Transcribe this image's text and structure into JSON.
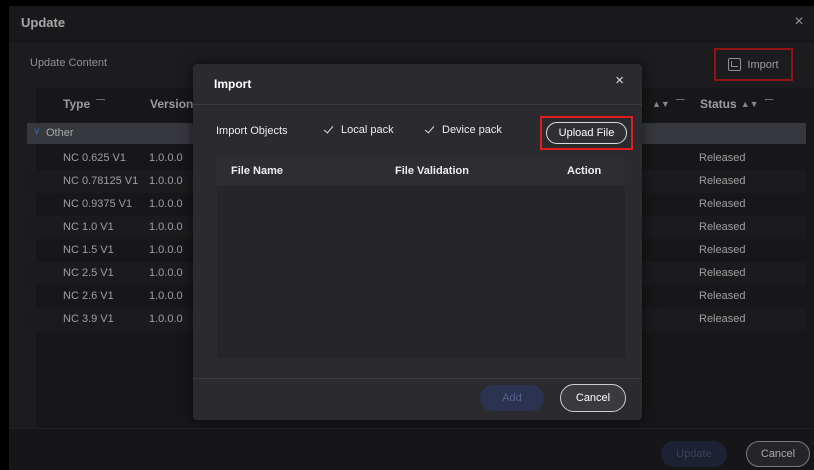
{
  "window": {
    "title": "Update",
    "close_icon": "×"
  },
  "section": {
    "title": "Update Content",
    "import_label": "Import"
  },
  "table": {
    "columns": {
      "type": "Type",
      "version": "Version",
      "status": "Status"
    },
    "group": {
      "label": "Other"
    },
    "rows": [
      {
        "type": "NC 0.625 V1",
        "version": "1.0.0.0",
        "status": "Released"
      },
      {
        "type": "NC 0.78125 V1",
        "version": "1.0.0.0",
        "status": "Released"
      },
      {
        "type": "NC 0.9375 V1",
        "version": "1.0.0.0",
        "status": "Released"
      },
      {
        "type": "NC 1.0 V1",
        "version": "1.0.0.0",
        "status": "Released"
      },
      {
        "type": "NC 1.5 V1",
        "version": "1.0.0.0",
        "status": "Released"
      },
      {
        "type": "NC 2.5 V1",
        "version": "1.0.0.0",
        "status": "Released"
      },
      {
        "type": "NC 2.6 V1",
        "version": "1.0.0.0",
        "status": "Released"
      },
      {
        "type": "NC 3.9 V1",
        "version": "1.0.0.0",
        "status": "Released"
      }
    ]
  },
  "footer": {
    "update_label": "Update",
    "cancel_label": "Cancel"
  },
  "dialog": {
    "title": "Import",
    "close_icon": "×",
    "objects_label": "Import Objects",
    "local_pack_label": "Local pack",
    "device_pack_label": "Device pack",
    "local_pack_checked": true,
    "device_pack_checked": true,
    "upload_label": "Upload File",
    "file_columns": {
      "name": "File Name",
      "validation": "File Validation",
      "action": "Action"
    },
    "add_label": "Add",
    "cancel_label": "Cancel"
  },
  "colors": {
    "highlight": "#e01e1e",
    "accent": "#4aa3ff",
    "disabled_button": "#2b3350"
  }
}
